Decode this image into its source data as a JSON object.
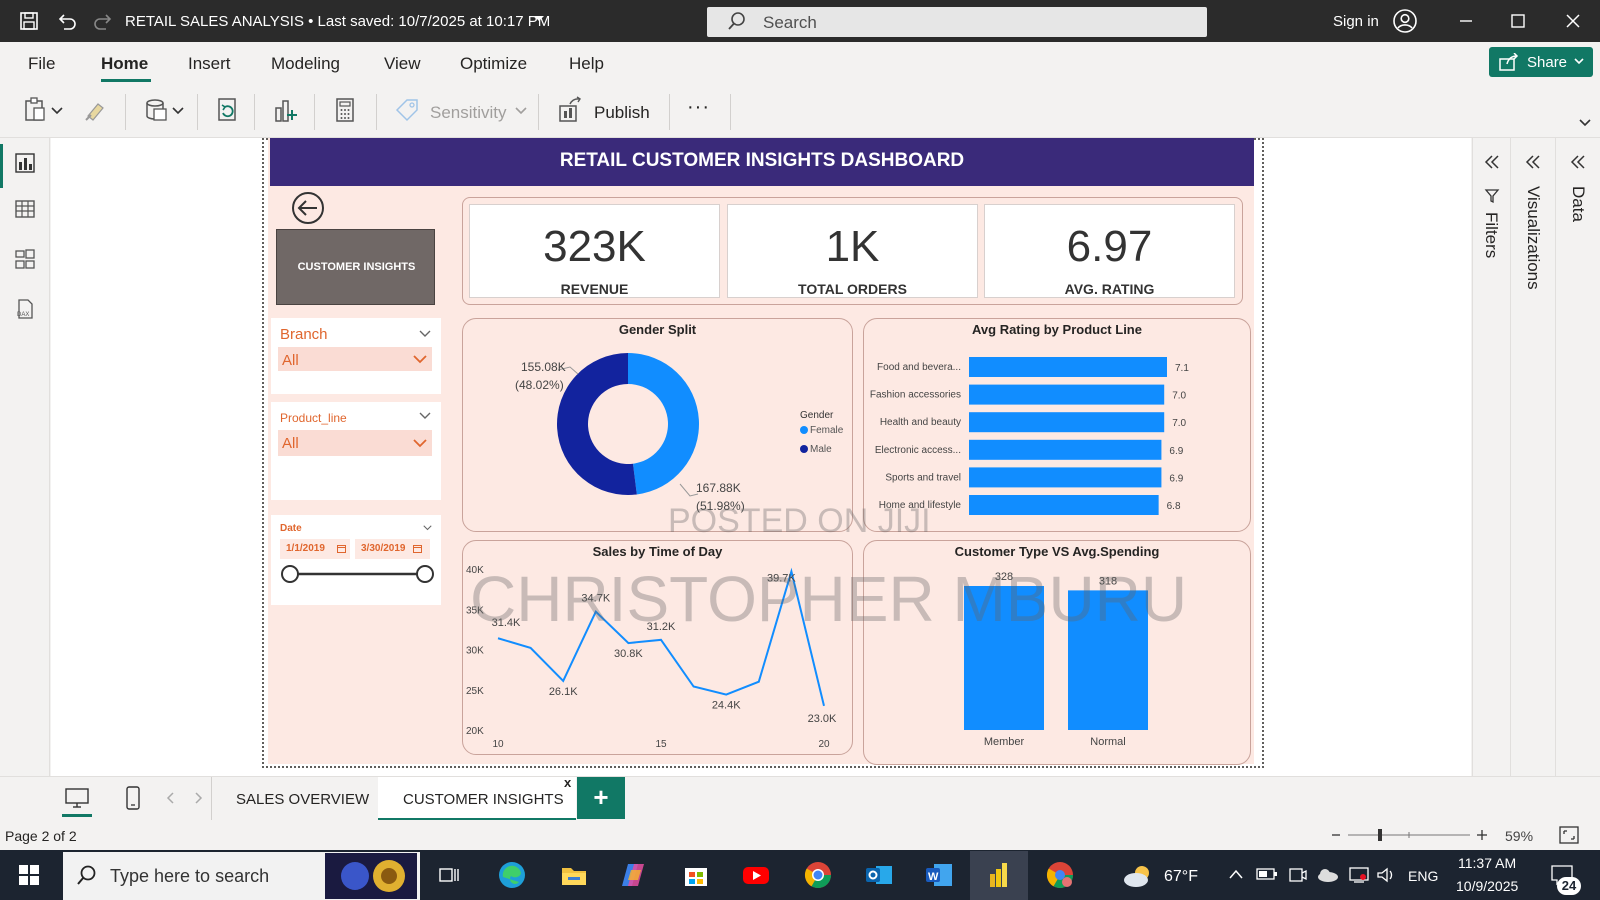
{
  "titlebar": {
    "title": "RETAIL SALES ANALYSIS • Last saved: 10/7/2025 at 10:17 PM",
    "search_placeholder": "Search",
    "signin": "Sign in"
  },
  "menu": {
    "items": [
      "File",
      "Home",
      "Insert",
      "Modeling",
      "View",
      "Optimize",
      "Help"
    ],
    "active": "Home",
    "share_label": "Share"
  },
  "toolbar": {
    "sensitivity_label": "Sensitivity",
    "publish_label": "Publish",
    "more_label": "···"
  },
  "dashboard": {
    "title": "RETAIL CUSTOMER INSIGHTS DASHBOARD",
    "nav_tile": "CUSTOMER INSIGHTS",
    "slicers": {
      "branch": {
        "title": "Branch",
        "value": "All"
      },
      "product_line": {
        "title": "Product_line",
        "value": "All"
      },
      "date": {
        "title": "Date",
        "start": "1/1/2019",
        "end": "3/30/2019"
      }
    },
    "kpis": [
      {
        "value": "323K",
        "label": "REVENUE"
      },
      {
        "value": "1K",
        "label": "TOTAL ORDERS"
      },
      {
        "value": "6.97",
        "label": "AVG. RATING"
      }
    ],
    "gender_split": {
      "title": "Gender Split",
      "legend_title": "Gender",
      "female_label": "155.08K",
      "female_pct": "(48.02%)",
      "male_label": "167.88K",
      "male_pct": "(51.98%)",
      "legend": [
        "Female",
        "Male"
      ]
    },
    "avg_rating_title": "Avg Rating by Product Line",
    "sales_time_title": "Sales by Time of Day",
    "customer_type_title": "Customer Type VS Avg.Spending"
  },
  "chart_data": [
    {
      "type": "pie",
      "title": "Gender Split",
      "legend_title": "Gender",
      "labels": [
        "Female",
        "Male"
      ],
      "values": [
        155.08,
        167.88
      ],
      "unit": "K",
      "colors": [
        "#118dff",
        "#12239e"
      ]
    },
    {
      "type": "bar",
      "orientation": "horizontal",
      "title": "Avg Rating by Product Line",
      "categories": [
        "Food and bevera...",
        "Fashion accessories",
        "Health and beauty",
        "Electronic access...",
        "Sports and travel",
        "Home and lifestyle"
      ],
      "values": [
        7.1,
        7.0,
        7.0,
        6.9,
        6.9,
        6.8
      ],
      "value_labels": [
        "7.1",
        "7.0",
        "7.0",
        "6.9",
        "6.9",
        "6.8"
      ],
      "color": "#118dff"
    },
    {
      "type": "line",
      "title": "Sales by Time of Day",
      "x": [
        10,
        11,
        12,
        13,
        14,
        15,
        16,
        17,
        18,
        19,
        20
      ],
      "y": [
        31.4,
        30.2,
        26.1,
        34.7,
        30.8,
        31.2,
        25.4,
        24.4,
        26.0,
        39.7,
        23.0
      ],
      "point_labels": {
        "0": "31.4K",
        "2": "26.1K",
        "3": "34.7K",
        "4": "30.8K",
        "5": "31.2K",
        "7": "24.4K",
        "9": "39.7K",
        "10": "23.0K"
      },
      "x_ticks": [
        "10",
        "15",
        "20"
      ],
      "y_ticks": [
        "20K",
        "25K",
        "30K",
        "35K",
        "40K"
      ],
      "ylim": [
        20,
        40
      ],
      "xlim": [
        10,
        20
      ],
      "color": "#118dff"
    },
    {
      "type": "bar",
      "title": "Customer Type VS Avg.Spending",
      "categories": [
        "Member",
        "Normal"
      ],
      "values": [
        328,
        318
      ],
      "value_labels": [
        "328",
        "318"
      ],
      "ylim": [
        0,
        328
      ],
      "color": "#118dff"
    }
  ],
  "watermark": {
    "line1": "POSTED ON JIJI",
    "line2": "CHRISTOPHER MBURU"
  },
  "panes": {
    "filters": "Filters",
    "visualizations": "Visualizations",
    "data": "Data"
  },
  "pages": {
    "tabs": [
      "SALES OVERVIEW",
      "CUSTOMER INSIGHTS"
    ],
    "active": "CUSTOMER INSIGHTS",
    "close": "x",
    "add": "+"
  },
  "status": {
    "page": "Page 2 of 2",
    "zoom": "59%"
  },
  "taskbar": {
    "search_placeholder": "Type here to search",
    "weather": "67°F",
    "lang": "ENG",
    "time": "11:37 AM",
    "date": "10/9/2025",
    "notif_count": "24"
  }
}
